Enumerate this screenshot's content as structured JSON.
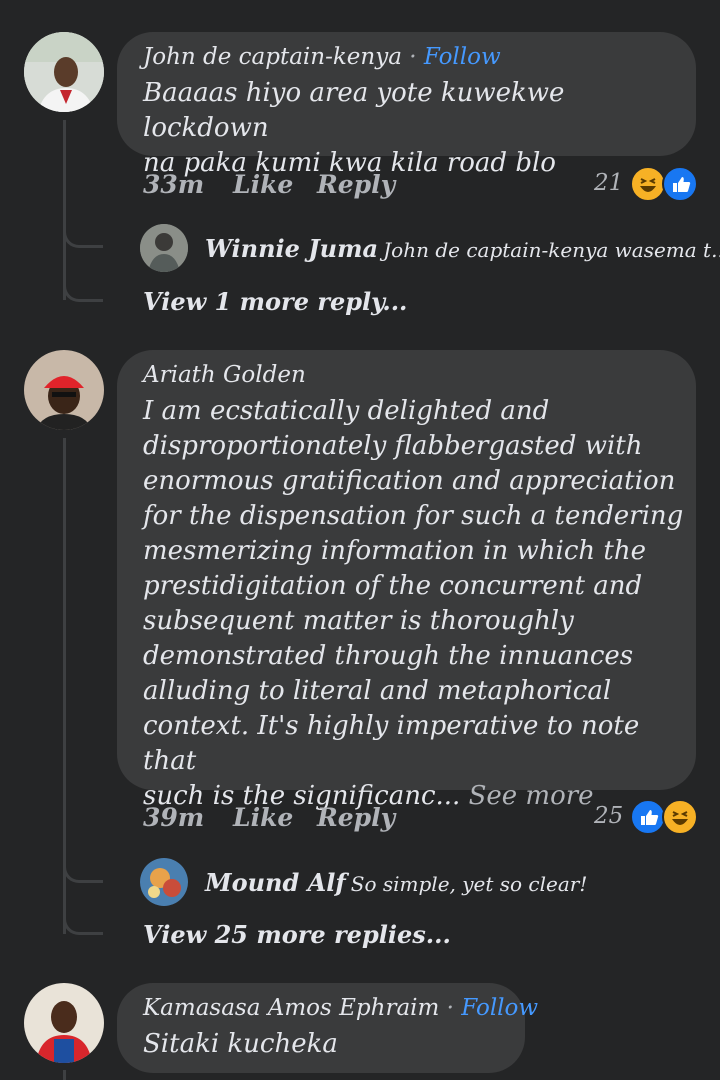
{
  "comments": [
    {
      "author": "John de captain-kenya",
      "separator": "·",
      "follow": "Follow",
      "lines": [
        "Baaaas hiyo area yote kuwekwe lockdown",
        "na paka kumi kwa kila  road blo"
      ],
      "time": "33m",
      "like": "Like",
      "reply": "Reply",
      "reaction_count": "21",
      "reactions": [
        "haha-icon",
        "like-icon"
      ],
      "reply_preview": {
        "author": "Winnie Juma",
        "text": "John de captain-kenya wasema t..."
      },
      "view_more": "View 1 more reply..."
    },
    {
      "author": "Ariath Golden",
      "lines": [
        "I am ecstatically delighted and",
        "disproportionately flabbergasted with",
        "enormous gratification and appreciation",
        "for the dispensation for such a tendering",
        "mesmerizing information in which the",
        "prestidigitation of the concurrent and",
        "subsequent matter is thoroughly",
        "demonstrated through the innuances",
        "alluding to literal and metaphorical",
        "context. It's highly imperative to note that",
        "such is the significanc..."
      ],
      "see_more": "See more",
      "time": "39m",
      "like": "Like",
      "reply": "Reply",
      "reaction_count": "25",
      "reactions": [
        "like-icon",
        "haha-icon"
      ],
      "reply_preview": {
        "author": "Mound Alf",
        "text": "So simple, yet so clear!"
      },
      "view_more": "View 25 more replies..."
    },
    {
      "author": "Kamasasa Amos Ephraim",
      "separator": "·",
      "follow": "Follow",
      "lines": [
        "Sitaki kucheka"
      ]
    }
  ],
  "colors": {
    "background": "#242526",
    "bubble": "#3a3b3c",
    "link": "#4599ff",
    "like": "#1877f2",
    "haha": "#f7b125"
  }
}
